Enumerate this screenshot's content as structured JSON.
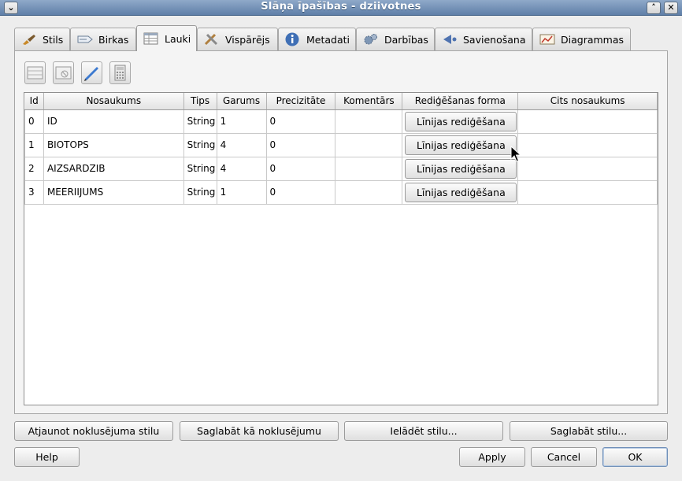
{
  "window": {
    "title": "Slāņa īpašības - dziivotnes",
    "menu_glyph": "⌄",
    "maximize_glyph": "˄",
    "close_glyph": "✕"
  },
  "tabs": [
    {
      "label": "Stils",
      "icon": "brush-icon",
      "active": false
    },
    {
      "label": "Birkas",
      "icon": "label-icon",
      "active": false
    },
    {
      "label": "Lauki",
      "icon": "table-icon",
      "active": true
    },
    {
      "label": "Vispārējs",
      "icon": "tools-icon",
      "active": false
    },
    {
      "label": "Metadati",
      "icon": "info-icon",
      "active": false
    },
    {
      "label": "Darbības",
      "icon": "gears-icon",
      "active": false
    },
    {
      "label": "Savienošana",
      "icon": "join-icon",
      "active": false
    },
    {
      "label": "Diagrammas",
      "icon": "chart-icon",
      "active": false
    }
  ],
  "toolbar": [
    {
      "icon": "new-column-icon"
    },
    {
      "icon": "delete-column-icon"
    },
    {
      "icon": "toggle-editing-icon"
    },
    {
      "icon": "field-calculator-icon"
    }
  ],
  "table": {
    "headers": [
      "Id",
      "Nosaukums",
      "Tips",
      "Garums",
      "Precizitāte",
      "Komentārs",
      "Rediģēšanas forma",
      "Cits nosaukums"
    ],
    "rows": [
      {
        "id": "0",
        "name": "ID",
        "type": "String",
        "length": "1",
        "precision": "0",
        "comment": "",
        "edit_form": "Līnijas rediģēšana",
        "alias": ""
      },
      {
        "id": "1",
        "name": "BIOTOPS",
        "type": "String",
        "length": "4",
        "precision": "0",
        "comment": "",
        "edit_form": "Līnijas rediģēšana",
        "alias": ""
      },
      {
        "id": "2",
        "name": "AIZSARDZIB",
        "type": "String",
        "length": "4",
        "precision": "0",
        "comment": "",
        "edit_form": "Līnijas rediģēšana",
        "alias": ""
      },
      {
        "id": "3",
        "name": "MEERIIJUMS",
        "type": "String",
        "length": "1",
        "precision": "0",
        "comment": "",
        "edit_form": "Līnijas rediģēšana",
        "alias": ""
      }
    ]
  },
  "style_buttons": {
    "restore_default": "Atjaunot noklusējuma stilu",
    "save_default": "Saglabāt kā noklusējumu",
    "load_style": "Ielādēt stilu...",
    "save_style": "Saglabāt stilu..."
  },
  "dialog_buttons": {
    "help": "Help",
    "apply": "Apply",
    "cancel": "Cancel",
    "ok": "OK"
  },
  "colors": {
    "titlebar": "#6f8db5",
    "panel": "#f4f4f4",
    "default_button_border": "#6f8fb8"
  }
}
